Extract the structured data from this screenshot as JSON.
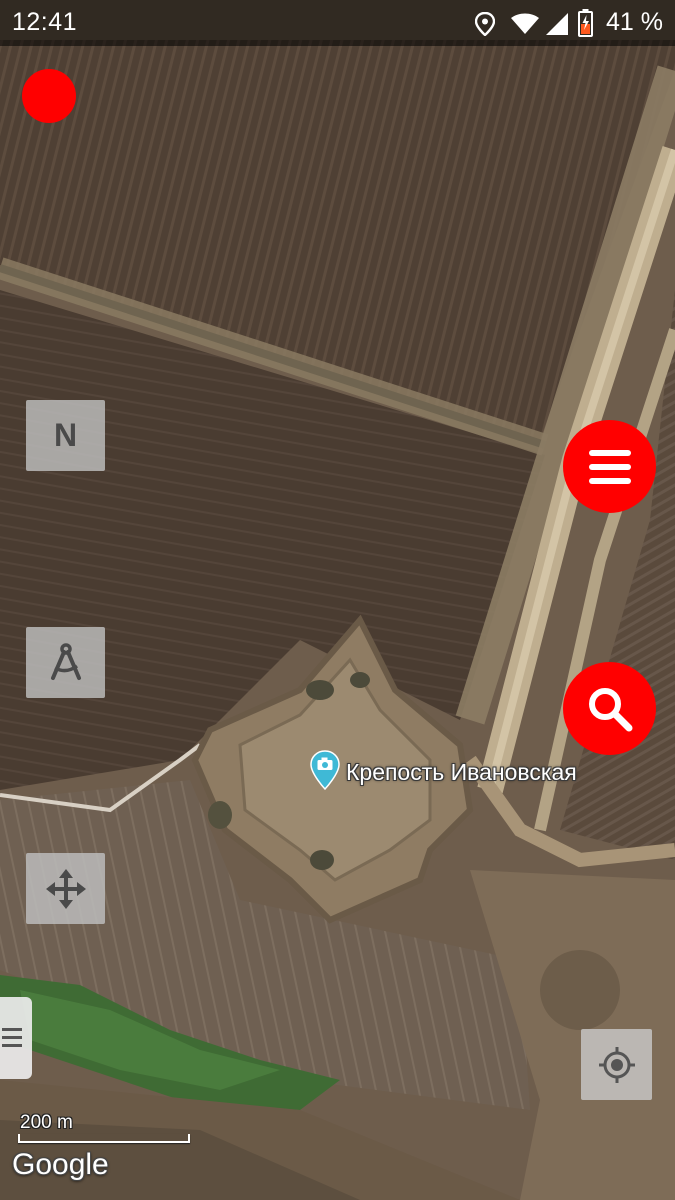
{
  "status_bar": {
    "time": "12:41",
    "battery_text": "41 %",
    "icons": [
      "location-icon",
      "wifi-icon",
      "cell-signal-icon",
      "battery-icon"
    ]
  },
  "controls": {
    "north_label": "N",
    "measure_icon": "compass-icon",
    "pan_icon": "move-icon",
    "locate_icon": "my-location-icon",
    "menu_icon": "menu-icon",
    "search_icon": "search-icon",
    "accent_color": "#ff0000"
  },
  "map": {
    "type": "satellite",
    "poi": {
      "label": "Крепость Ивановская",
      "icon": "camera-pin-icon",
      "pin_color": "#3fb9d6"
    },
    "scale_label": "200 m",
    "attribution": "Google"
  }
}
